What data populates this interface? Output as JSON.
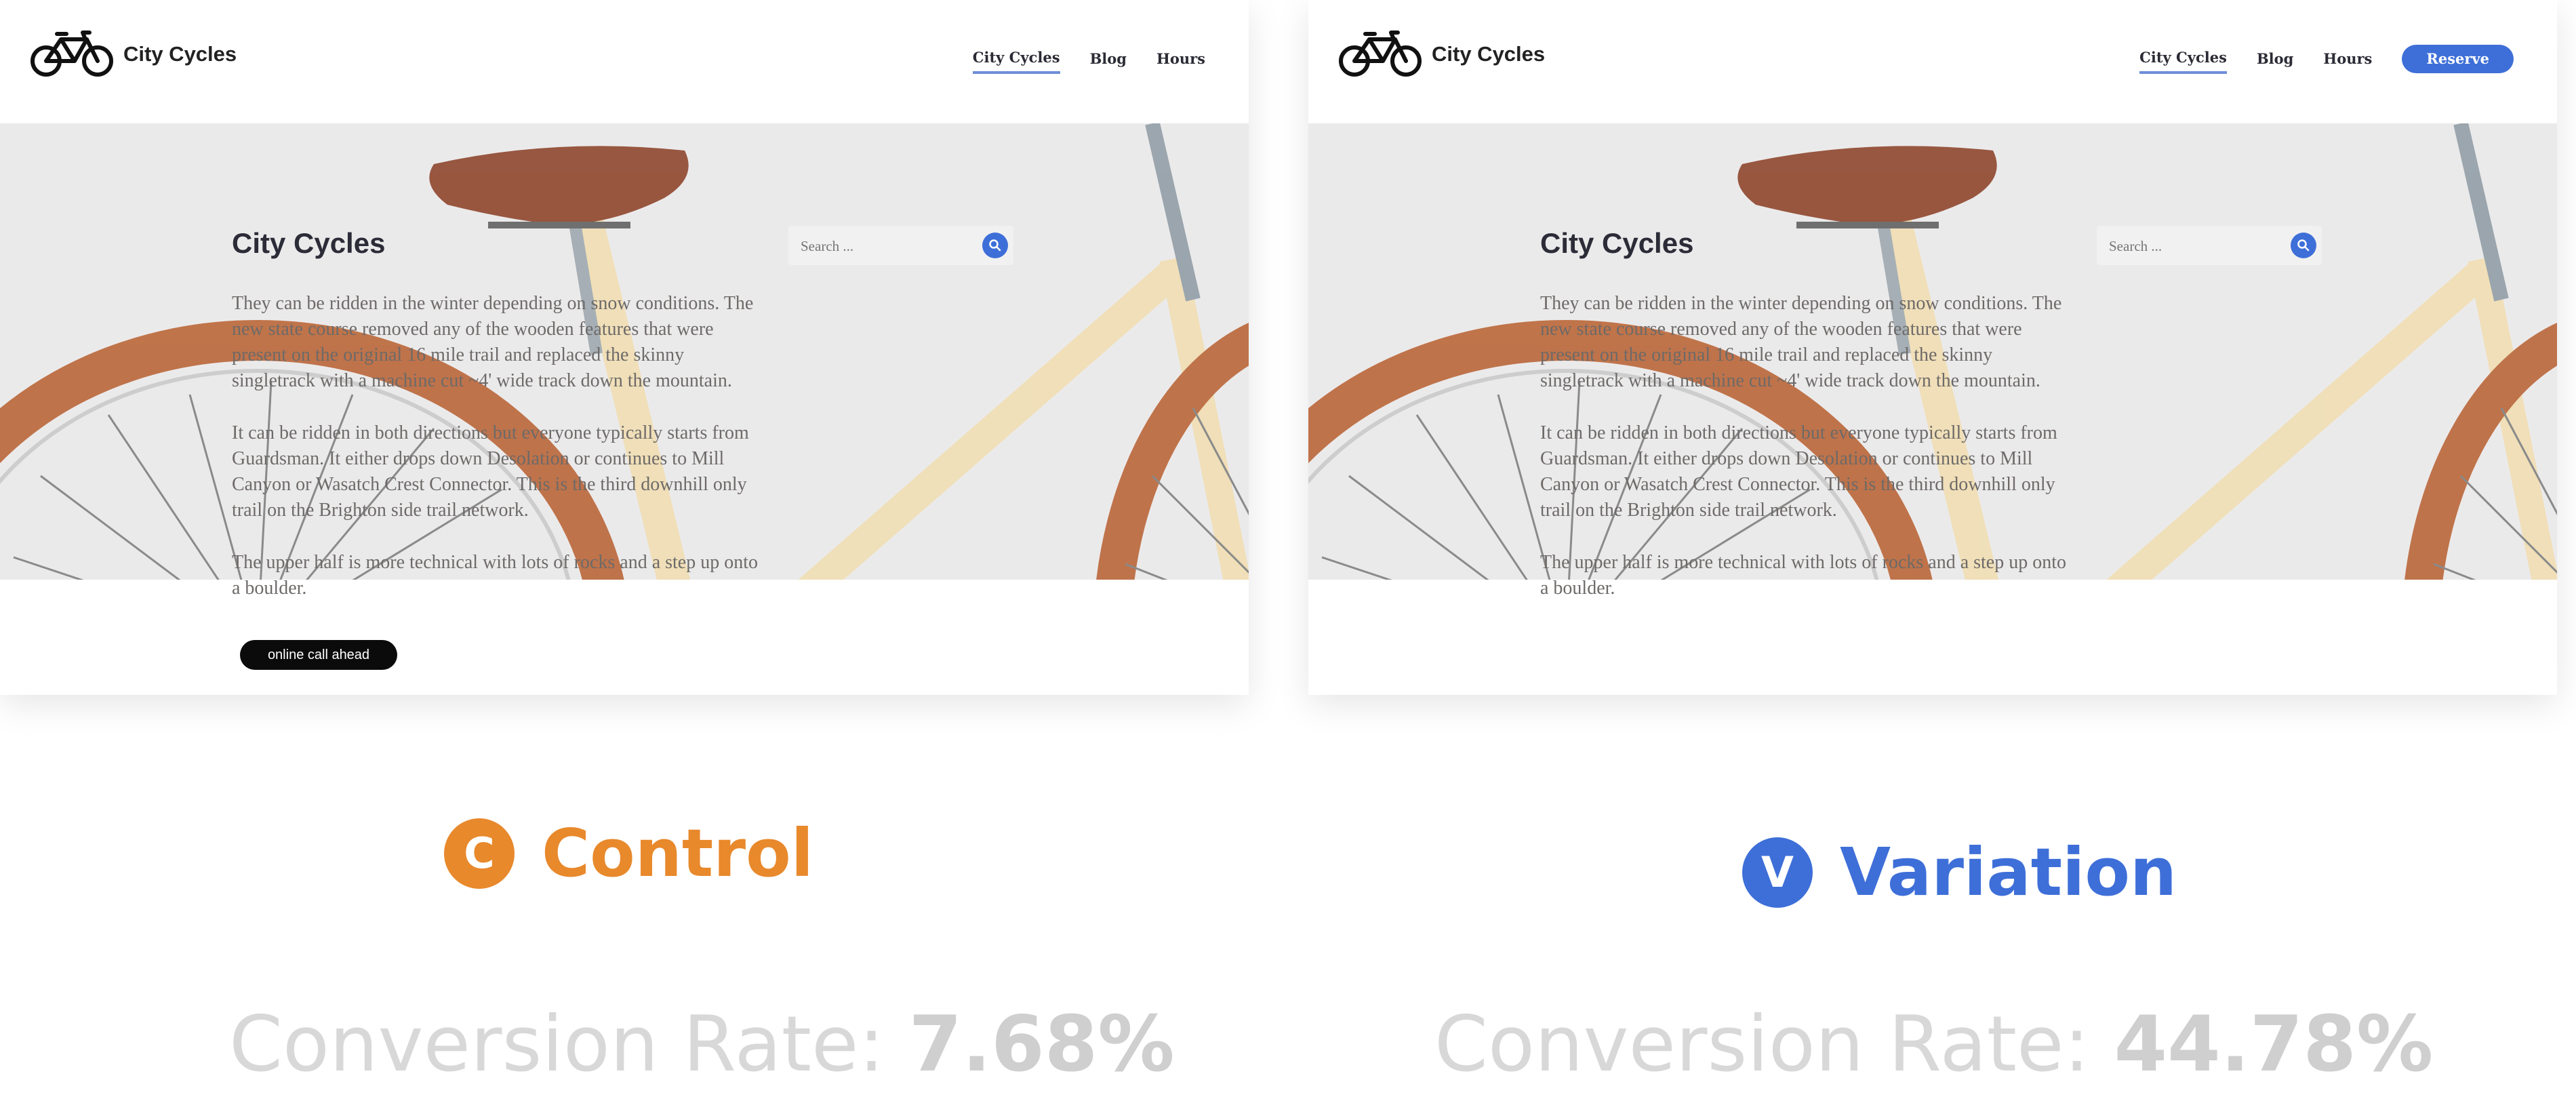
{
  "brand": {
    "name": "City Cycles"
  },
  "nav": {
    "city_cycles": "City Cycles",
    "blog": "Blog",
    "hours": "Hours",
    "reserve": "Reserve"
  },
  "content": {
    "title": "City Cycles",
    "paragraphs": [
      "They can be ridden in the winter depending on snow conditions. The new state course removed any of the wooden features that were present on the original 16 mile trail and replaced the skinny singletrack with a machine cut ~4' wide track down the mountain.",
      "It can be ridden in both directions but everyone typically starts from Guardsman. It either drops down Desolation or continues to Mill Canyon or Wasatch Crest Connector. This is the third downhill only trail on the Brighton side trail network.",
      "The upper half is more technical with lots of rocks and a step up onto a boulder."
    ],
    "cta": "online call ahead"
  },
  "search": {
    "placeholder": "Search ..."
  },
  "control": {
    "badge": "C",
    "label": "Control",
    "rate_label": "Conversion Rate: ",
    "rate_value": "7.68%"
  },
  "variation": {
    "badge": "V",
    "label": "Variation",
    "rate_label": "Conversion Rate: ",
    "rate_value": "44.78%"
  },
  "colors": {
    "control_accent": "#e8892c",
    "variation_accent": "#3e6fd8",
    "hero_bg": "#ebeaeb"
  },
  "icons": [
    "bicycle-logo-icon",
    "search-icon"
  ]
}
